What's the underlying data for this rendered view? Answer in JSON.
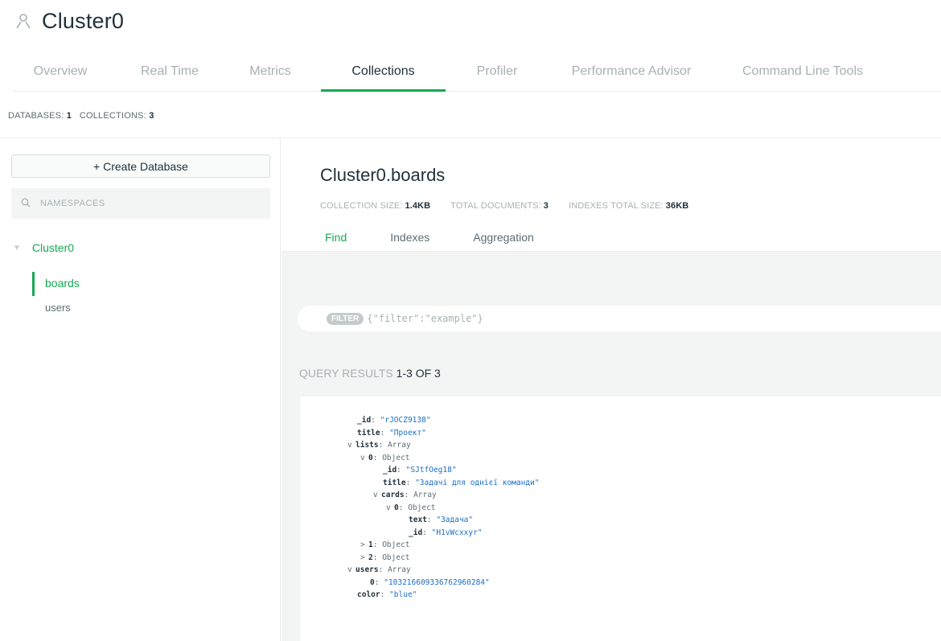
{
  "header": {
    "title": "Cluster0",
    "icon": "cluster-icon"
  },
  "tabs": [
    {
      "label": "Overview",
      "active": false
    },
    {
      "label": "Real Time",
      "active": false
    },
    {
      "label": "Metrics",
      "active": false
    },
    {
      "label": "Collections",
      "active": true
    },
    {
      "label": "Profiler",
      "active": false
    },
    {
      "label": "Performance Advisor",
      "active": false
    },
    {
      "label": "Command Line Tools",
      "active": false
    }
  ],
  "stats": {
    "databases_label": "DATABASES:",
    "databases_value": "1",
    "collections_label": "COLLECTIONS:",
    "collections_value": "3"
  },
  "sidebar": {
    "create_label": "+ Create Database",
    "search_placeholder": "NAMESPACES",
    "database": "Cluster0",
    "collections": [
      "boards",
      "users"
    ],
    "active_collection": "boards"
  },
  "collection": {
    "title": "Cluster0.boards",
    "size_label": "COLLECTION SIZE:",
    "size_value": "1.4KB",
    "docs_label": "TOTAL DOCUMENTS:",
    "docs_value": "3",
    "indexes_label": "INDEXES TOTAL SIZE:",
    "indexes_value": "36KB",
    "tabs": [
      "Find",
      "Indexes",
      "Aggregation"
    ],
    "active_tab": "Find"
  },
  "query": {
    "filter_badge": "FILTER",
    "filter_placeholder": "{\"filter\":\"example\"}",
    "results_label": "QUERY RESULTS",
    "results_range": "1-3 OF 3"
  },
  "document": [
    {
      "depth": 0,
      "exp": "",
      "key": "_id",
      "type": "",
      "value": "\"rJOCZ9138\""
    },
    {
      "depth": 0,
      "exp": "",
      "key": "title",
      "type": "",
      "value": "\"Проект\""
    },
    {
      "depth": 0,
      "exp": "v",
      "key": "lists",
      "type": "Array",
      "value": ""
    },
    {
      "depth": 1,
      "exp": "v",
      "key": "0",
      "type": "Object",
      "value": ""
    },
    {
      "depth": 2,
      "exp": "",
      "key": "_id",
      "type": "",
      "value": "\"SJtfOeg18\""
    },
    {
      "depth": 2,
      "exp": "",
      "key": "title",
      "type": "",
      "value": "\"Задачі для однієї команди\""
    },
    {
      "depth": 2,
      "exp": "v",
      "key": "cards",
      "type": "Array",
      "value": ""
    },
    {
      "depth": 3,
      "exp": "v",
      "key": "0",
      "type": "Object",
      "value": ""
    },
    {
      "depth": 4,
      "exp": "",
      "key": "text",
      "type": "",
      "value": "\"Задача\""
    },
    {
      "depth": 4,
      "exp": "",
      "key": "_id",
      "type": "",
      "value": "\"H1vWcxxyr\""
    },
    {
      "depth": 1,
      "exp": ">",
      "key": "1",
      "type": "Object",
      "value": ""
    },
    {
      "depth": 1,
      "exp": ">",
      "key": "2",
      "type": "Object",
      "value": ""
    },
    {
      "depth": 0,
      "exp": "v",
      "key": "users",
      "type": "Array",
      "value": ""
    },
    {
      "depth": 1,
      "exp": "",
      "key": "0",
      "type": "",
      "value": "\"103216609336762960284\""
    },
    {
      "depth": 0,
      "exp": "",
      "key": "color",
      "type": "",
      "value": "\"blue\""
    }
  ],
  "colors": {
    "accent": "#13aa52",
    "string": "#1a6ec5",
    "panel": "#f3f5f4"
  }
}
